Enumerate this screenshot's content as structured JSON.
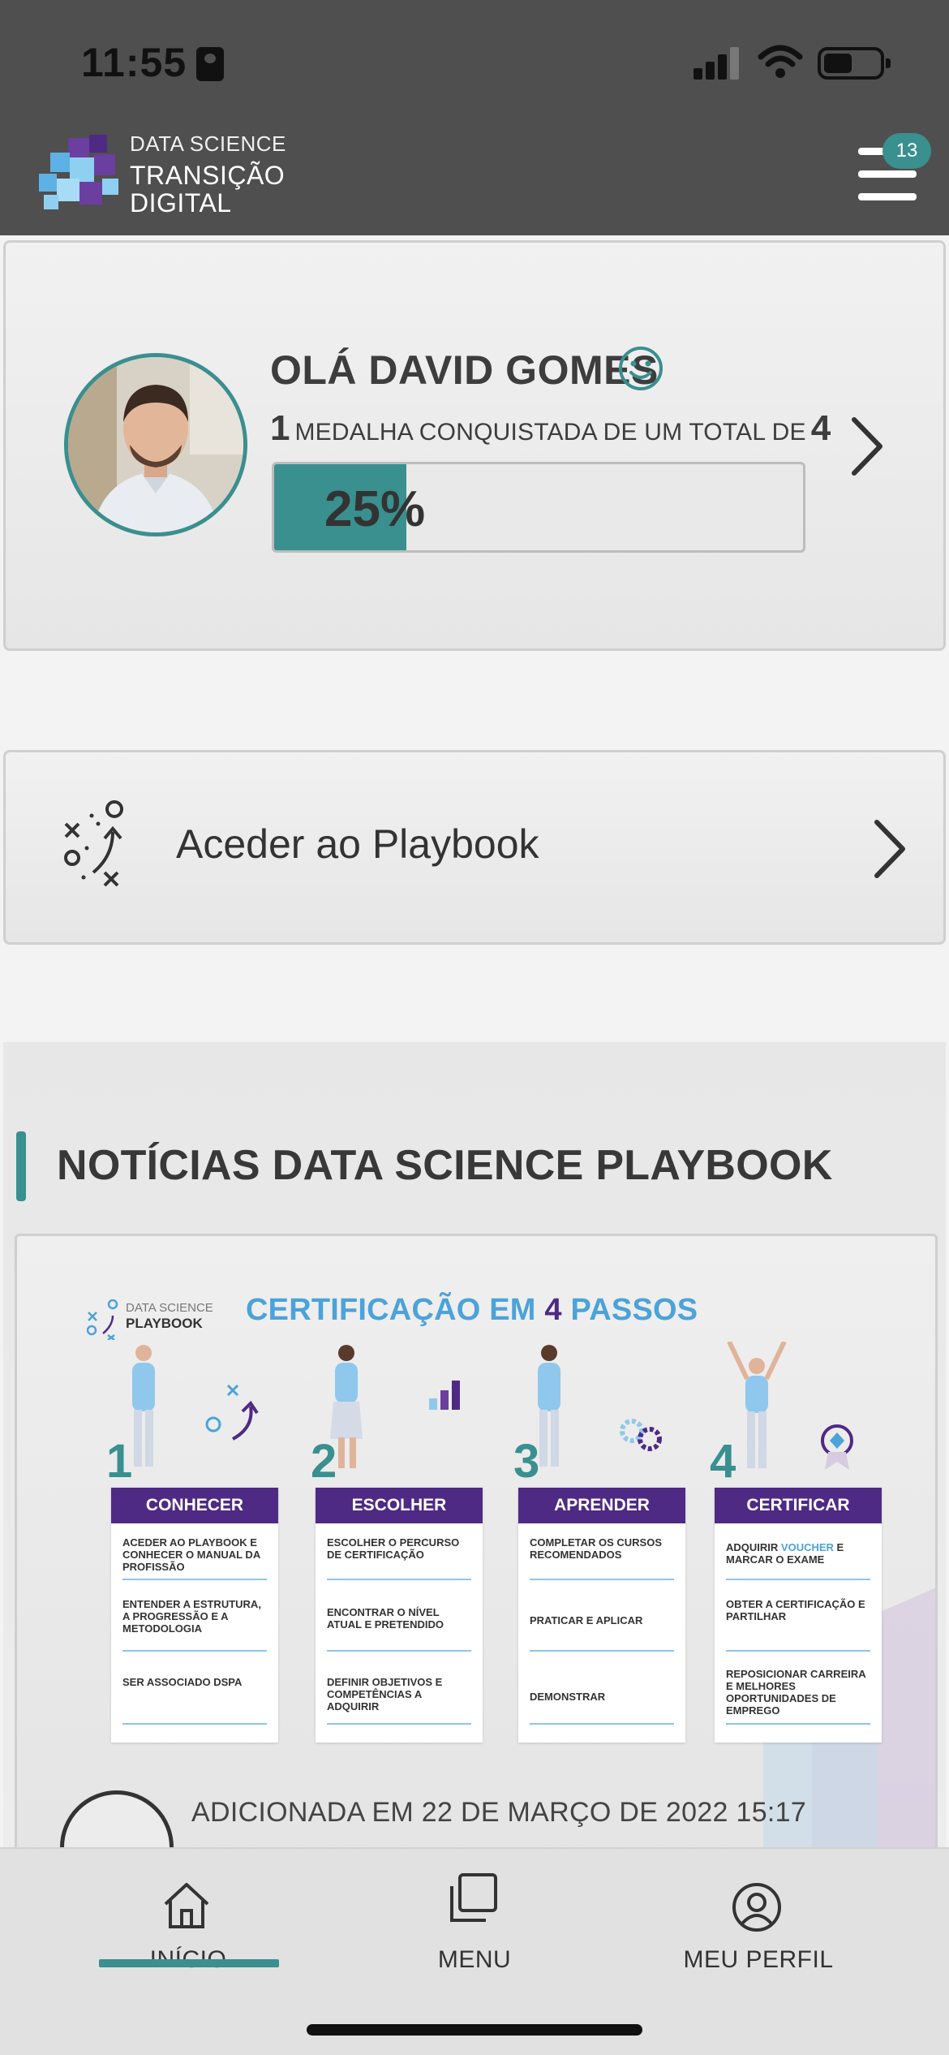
{
  "status_bar": {
    "time": "11:55"
  },
  "header": {
    "logo_line1": "DATA SCIENCE",
    "logo_line2": "TRANSIÇÃO",
    "logo_line3": "DIGITAL",
    "notification_count": "13"
  },
  "profile": {
    "greeting": "OLÁ DAVID GOMES",
    "medals_won": "1",
    "medals_text": "MEDALHA CONQUISTADA DE UM TOTAL DE",
    "medals_total": "4",
    "progress_label": "25%",
    "progress_fraction": 0.25
  },
  "playbook": {
    "label": "Aceder ao Playbook"
  },
  "news": {
    "section_title": "NOTÍCIAS DATA SCIENCE PLAYBOOK",
    "date_text": "ADICIONADA EM 22 DE MARÇO DE 2022 15:17",
    "infographic": {
      "brand_line1": "DATA SCIENCE",
      "brand_line2": "PLAYBOOK",
      "title_part1": "CERTIFICAÇÃO EM",
      "title_num": "4",
      "title_part2": "PASSOS",
      "steps": [
        {
          "num": "1",
          "title": "CONHECER",
          "items": [
            "ACEDER AO PLAYBOOK E CONHECER O MANUAL DA PROFISSÃO",
            "ENTENDER A ESTRUTURA, A PROGRESSÃO E A METODOLOGIA",
            "SER ASSOCIADO DSPA"
          ]
        },
        {
          "num": "2",
          "title": "ESCOLHER",
          "items": [
            "ESCOLHER O PERCURSO DE CERTIFICAÇÃO",
            "ENCONTRAR O NÍVEL ATUAL E PRETENDIDO",
            "DEFINIR OBJETIVOS E COMPETÊNCIAS A ADQUIRIR"
          ]
        },
        {
          "num": "3",
          "title": "APRENDER",
          "items": [
            "COMPLETAR OS CURSOS RECOMENDADOS",
            "PRATICAR E APLICAR",
            "DEMONSTRAR"
          ]
        },
        {
          "num": "4",
          "title": "CERTIFICAR",
          "items_pre": "ADQUIRIR",
          "items_hl": "VOUCHER",
          "items_post": "E MARCAR O EXAME",
          "items": [
            "OBTER A CERTIFICAÇÃO E PARTILHAR",
            "REPOSICIONAR CARREIRA E MELHORES OPORTUNIDADES DE EMPREGO"
          ]
        }
      ]
    }
  },
  "bottom_nav": {
    "home": "INÍCIO",
    "menu": "MENU",
    "profile": "MEU PERFIL"
  },
  "colors": {
    "accent": "#3a8f8f",
    "header_bg": "#4f4f4f",
    "purple": "#4e2a84",
    "blue": "#4ba3d9"
  }
}
